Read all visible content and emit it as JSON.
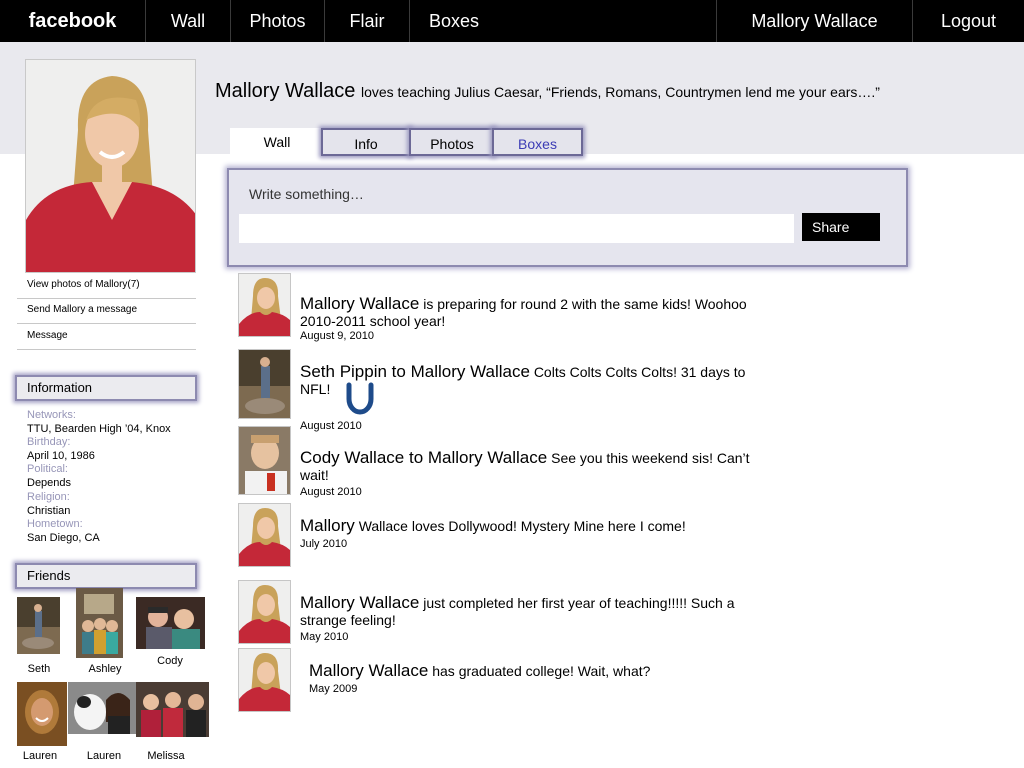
{
  "topnav": {
    "logo": "facebook",
    "wall": "Wall",
    "photos": "Photos",
    "flair": "Flair",
    "boxes": "Boxes",
    "user": "Mallory Wallace",
    "logout": "Logout"
  },
  "profile": {
    "name": "Mallory Wallace",
    "status": "loves teaching Julius Caesar, “Friends, Romans, Countrymen lend me your ears….”"
  },
  "sidebar": {
    "view_photos": "View photos of Mallory(7)",
    "send_message": "Send Mallory a message",
    "message": "Message"
  },
  "information": {
    "heading": "Information",
    "networks_label": "Networks:",
    "networks": "TTU, Bearden High ’04, Knox",
    "birthday_label": "Birthday:",
    "birthday": "April 10, 1986",
    "political_label": "Political:",
    "political": "Depends",
    "religion_label": "Religion:",
    "religion": "Christian",
    "hometown_label": "Hometown:",
    "hometown": "San Diego, CA"
  },
  "friends": {
    "heading": "Friends",
    "list": [
      {
        "name": "Seth"
      },
      {
        "name": "Ashley"
      },
      {
        "name": "Cody"
      },
      {
        "name": "Lauren"
      },
      {
        "name": "Lauren"
      },
      {
        "name": "Melissa"
      }
    ]
  },
  "tabs": {
    "wall": "Wall",
    "info": "Info",
    "photos": "Photos",
    "boxes": "Boxes"
  },
  "composer": {
    "label": "Write something…",
    "share": "Share"
  },
  "posts": [
    {
      "author": "Mallory Wallace",
      "text": "is preparing for round 2 with the same kids!  Woohoo 2010-2011 school year!",
      "date": "August 9, 2010"
    },
    {
      "author": "Seth Pippin to Mallory Wallace",
      "text": "Colts Colts Colts Colts!  31 days to NFL!",
      "date": "August 2010"
    },
    {
      "author": "Cody Wallace to Mallory Wallace",
      "text": "See you this weekend sis!  Can’t wait!",
      "date": "August  2010"
    },
    {
      "author": "Mallory",
      "text": "Wallace loves Dollywood!  Mystery Mine here I come!",
      "date": "July  2010"
    },
    {
      "author": "Mallory Wallace",
      "text": "just completed her first year of teaching!!!!! Such a strange feeling!",
      "date": "May  2010"
    },
    {
      "author": "Mallory Wallace",
      "text": "has graduated college!  Wait, what?",
      "date": "May 2009"
    }
  ],
  "colors": {
    "nav_bg": "#000000",
    "band_bg": "#e9e9ee",
    "box_border": "#8d8ab0",
    "label_color": "#9796b8",
    "boxes_tab_text": "#3b3bb5"
  }
}
